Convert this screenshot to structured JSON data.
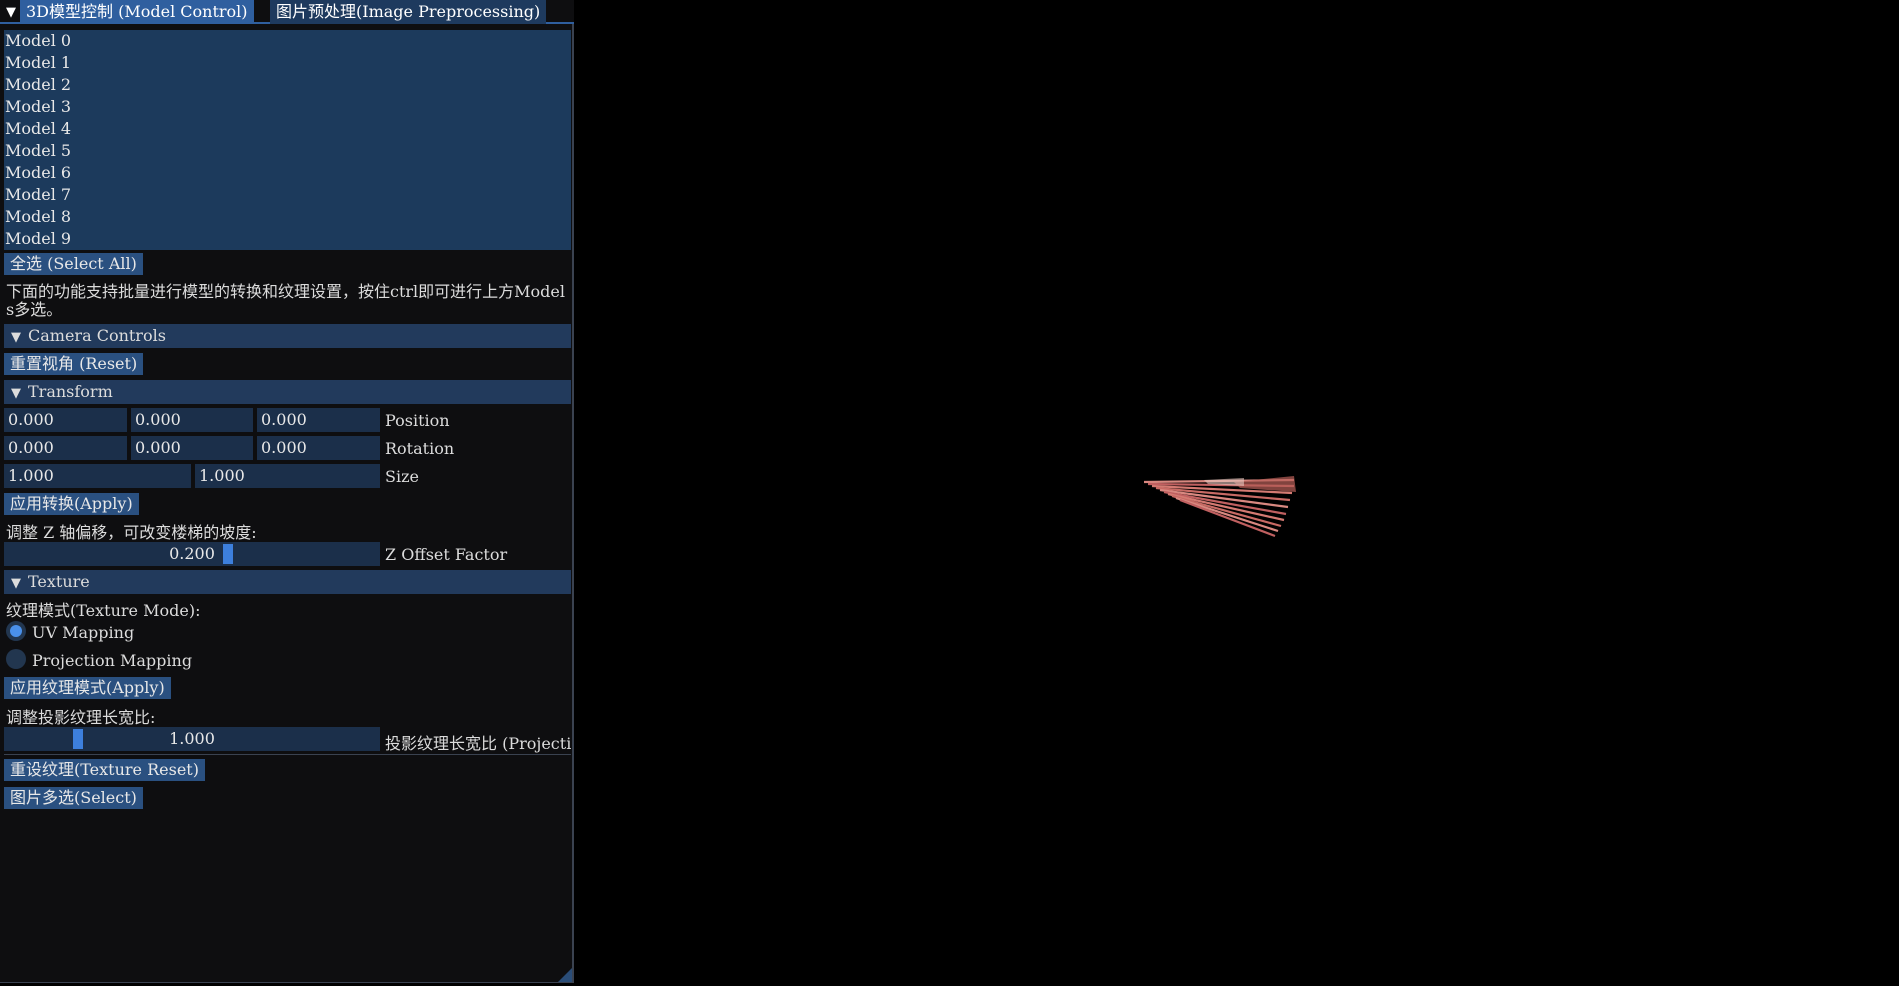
{
  "tabs": [
    {
      "label": "3D模型控制 (Model Control)"
    },
    {
      "label": "图片预处理(Image Preprocessing)"
    }
  ],
  "models": [
    "Model 0",
    "Model 1",
    "Model 2",
    "Model 3",
    "Model 4",
    "Model 5",
    "Model 6",
    "Model 7",
    "Model 8",
    "Model 9"
  ],
  "select_all_label": "全选 (Select All)",
  "batch_note": "下面的功能支持批量进行模型的转换和纹理设置，按住ctrl即可进行上方Models多选。",
  "camera": {
    "header": "Camera Controls",
    "reset_label": "重置视角 (Reset)"
  },
  "transform": {
    "header": "Transform",
    "position": {
      "label": "Position",
      "x": "0.000",
      "y": "0.000",
      "z": "0.000"
    },
    "rotation": {
      "label": "Rotation",
      "x": "0.000",
      "y": "0.000",
      "z": "0.000"
    },
    "size": {
      "label": "Size",
      "x": "1.000",
      "y": "1.000"
    },
    "apply_label": "应用转换(Apply)",
    "z_offset_note": "调整 Z 轴偏移，可改变楼梯的坡度:",
    "z_offset": {
      "label": "Z Offset Factor",
      "value": "0.200"
    }
  },
  "texture": {
    "header": "Texture",
    "mode_label": "纹理模式(Texture Mode):",
    "options": [
      {
        "label": "UV Mapping",
        "selected": true
      },
      {
        "label": "Projection Mapping",
        "selected": false
      }
    ],
    "apply_mode_label": "应用纹理模式(Apply)",
    "aspect_note": "调整投影纹理长宽比:",
    "aspect": {
      "label": "投影纹理长宽比 (Projection Aspect)",
      "value": "1.000"
    },
    "reset_label": "重设纹理(Texture Reset)",
    "select_images_label": "图片多选(Select)"
  },
  "colors": {
    "accent": "#2f5f9f",
    "list_bg": "#1c3a5c",
    "grab": "#3d7fdc"
  }
}
